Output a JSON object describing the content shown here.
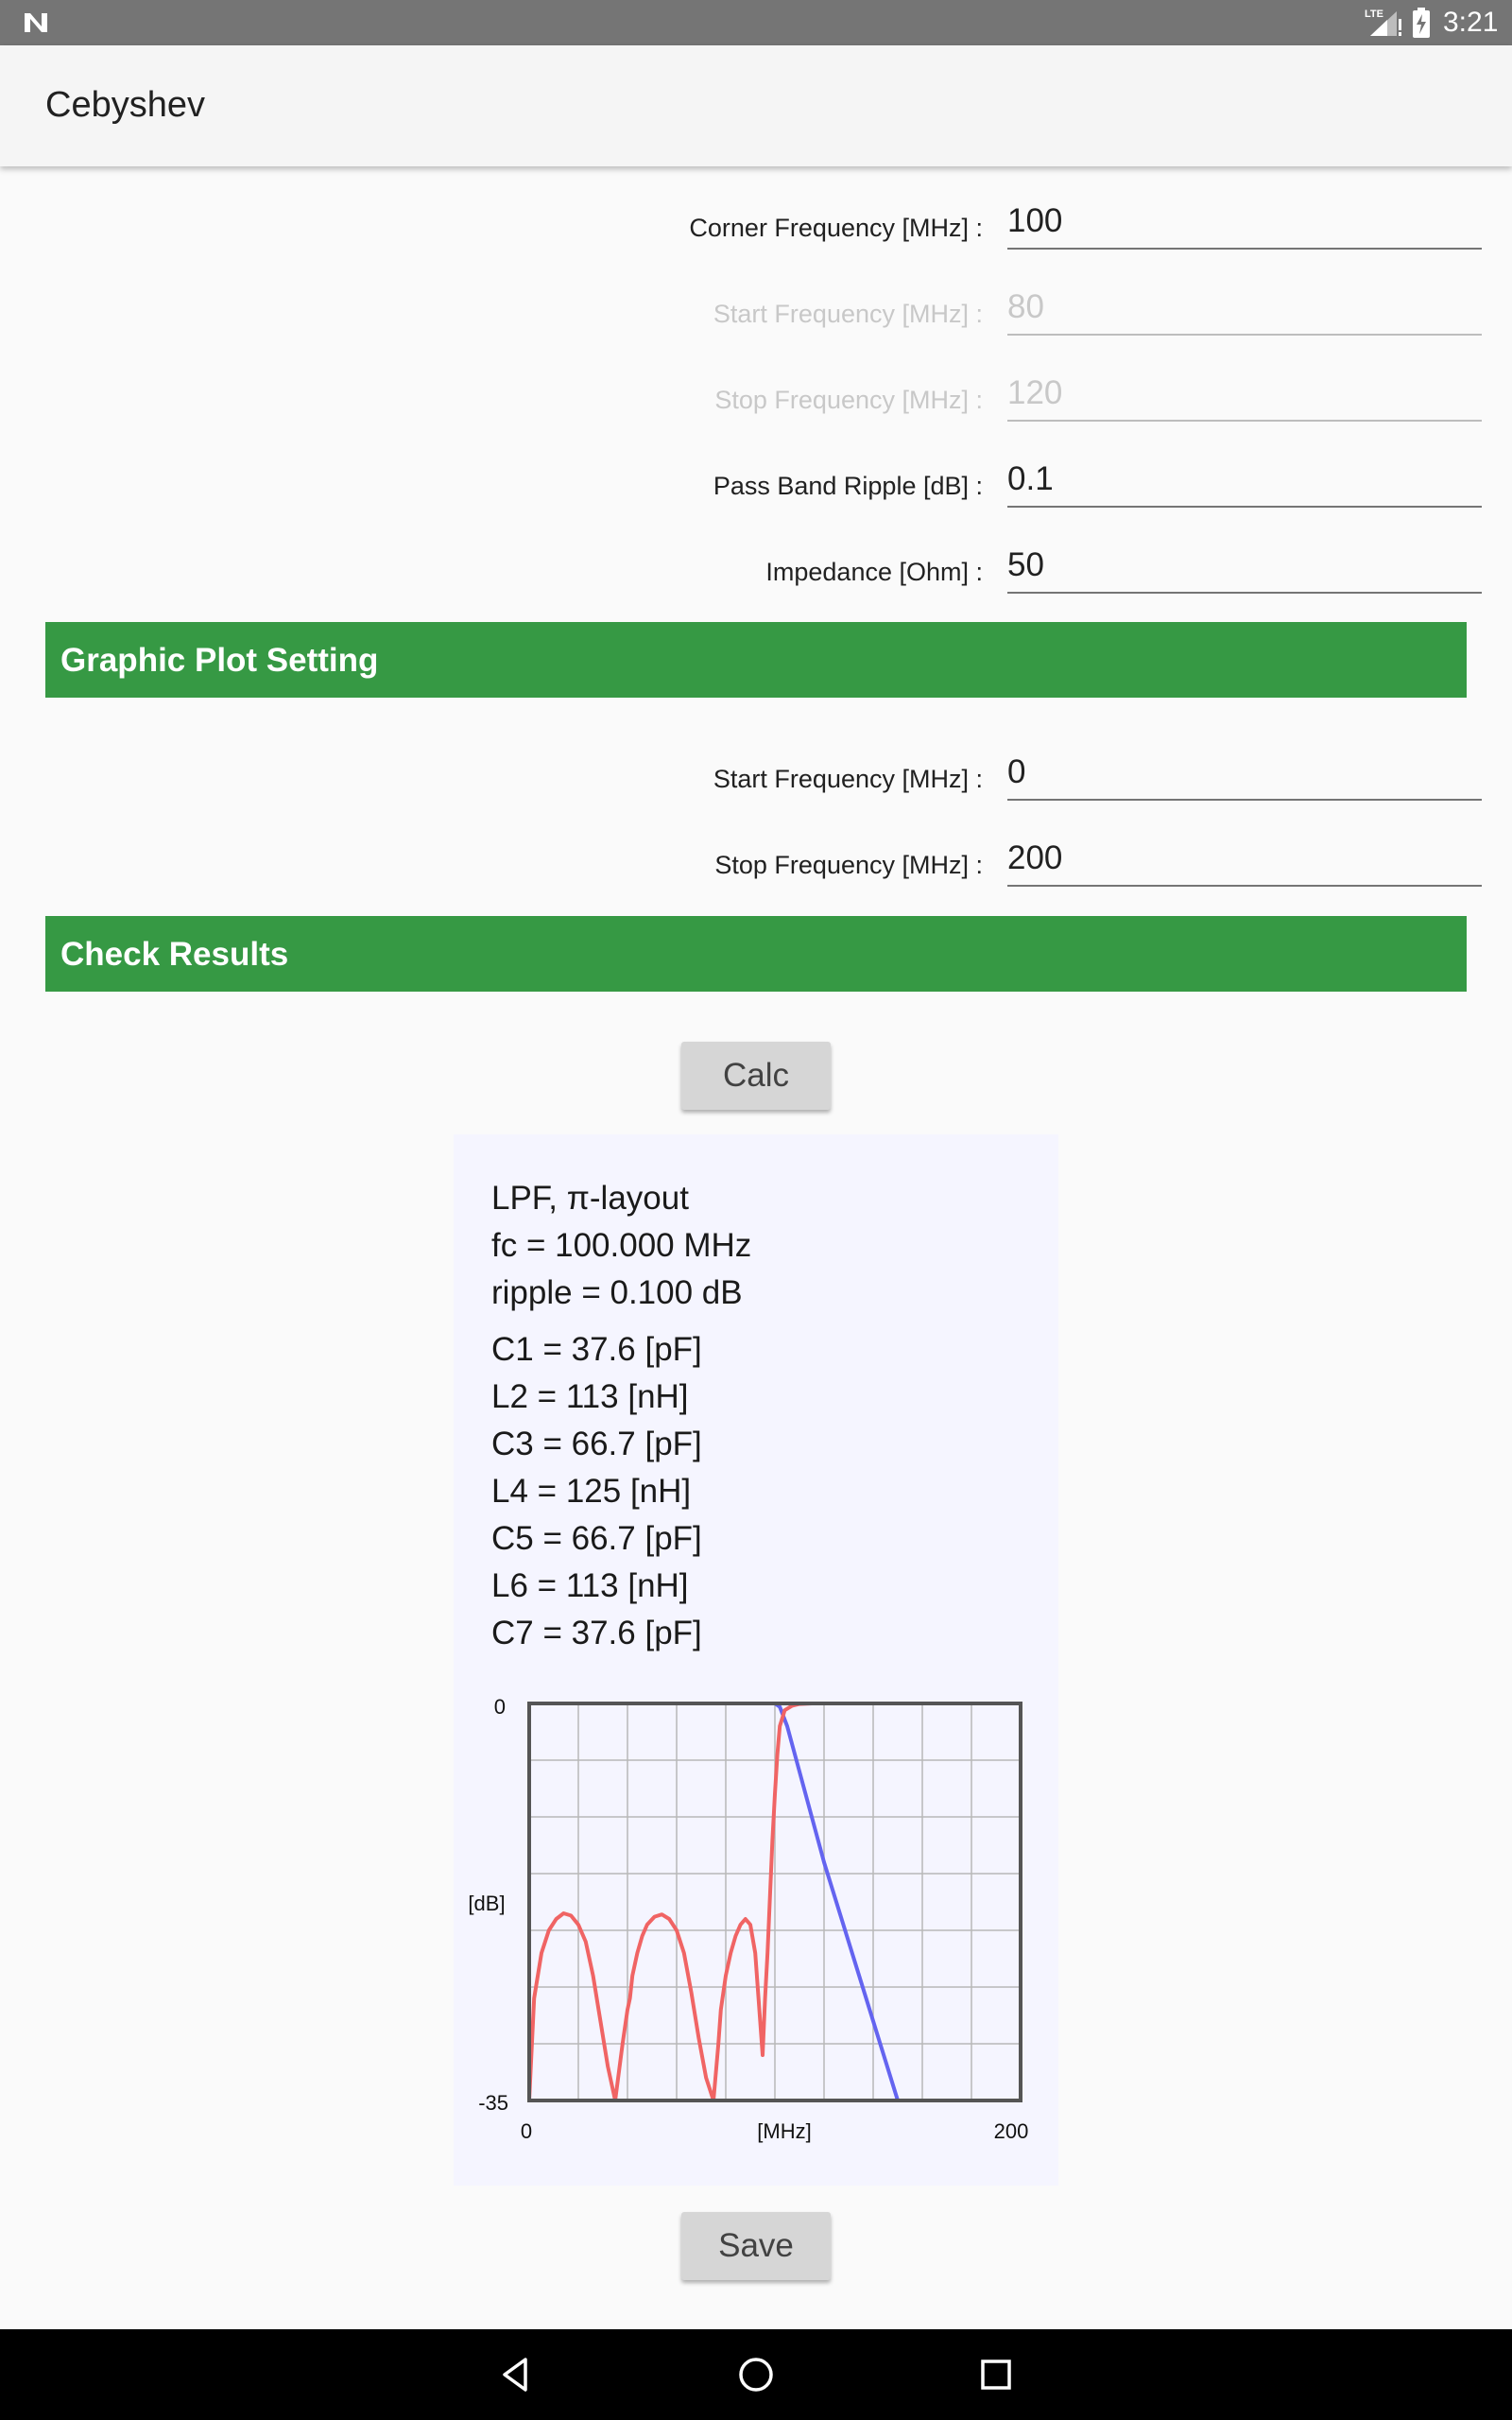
{
  "status_bar": {
    "time": "3:21",
    "network": "LTE"
  },
  "app_bar": {
    "title": "Cebyshev"
  },
  "form": {
    "corner": {
      "label": "Corner Frequency [MHz] :",
      "value": "100"
    },
    "start": {
      "label": "Start Frequency [MHz] :",
      "value": "80"
    },
    "stop": {
      "label": "Stop Frequency [MHz] :",
      "value": "120"
    },
    "ripple": {
      "label": "Pass Band Ripple [dB] :",
      "value": "0.1"
    },
    "impedance": {
      "label": "Impedance [Ohm] :",
      "value": "50"
    }
  },
  "plot_setting": {
    "header": "Graphic Plot Setting",
    "start": {
      "label": "Start Frequency [MHz] :",
      "value": "0"
    },
    "stop": {
      "label": "Stop Frequency [MHz] :",
      "value": "200"
    }
  },
  "results": {
    "header": "Check Results",
    "calc_label": "Calc",
    "save_label": "Save",
    "summary": [
      "LPF, π-layout",
      "fc = 100.000 MHz",
      "ripple = 0.100 dB"
    ],
    "components": [
      "C1 = 37.6 [pF]",
      "L2 = 113 [nH]",
      "C3 = 66.7 [pF]",
      "L4 = 125 [nH]",
      "C5 = 66.7 [pF]",
      "L6 = 113 [nH]",
      "C7 = 37.6 [pF]"
    ]
  },
  "colors": {
    "section_green": "#369944",
    "transmission": "#6464f0",
    "reflection": "#f06464"
  },
  "chart_data": {
    "type": "line",
    "ylabel": "[dB]",
    "xlabel": "[MHz]",
    "xlim": [
      0,
      200
    ],
    "ylim": [
      -35,
      0
    ],
    "y_tick_labels": [
      "0",
      "-35"
    ],
    "x_tick_labels": [
      "0",
      "200"
    ],
    "grid": true,
    "series": [
      {
        "color": "#6464f0",
        "x": [
          0,
          100,
          102,
          105,
          110,
          115,
          120,
          125,
          130,
          135,
          140,
          145,
          150,
          200
        ],
        "y": [
          0,
          0,
          -0.3,
          -2,
          -6,
          -10,
          -14,
          -17.5,
          -21,
          -24.5,
          -28,
          -31.5,
          -35,
          -35
        ]
      },
      {
        "color": "#f06464",
        "x": [
          0,
          2,
          5,
          8,
          11,
          14,
          17,
          20,
          23,
          26,
          29,
          32,
          35,
          38,
          40,
          41,
          42,
          44,
          46,
          48,
          51,
          54,
          57,
          60,
          63,
          66,
          69,
          72,
          75,
          77,
          78,
          80,
          82,
          84,
          86,
          88,
          90,
          92,
          93,
          94,
          95,
          96,
          97,
          98,
          99,
          100,
          101,
          102,
          104,
          107,
          110,
          115,
          120,
          200
        ],
        "y": [
          -35,
          -26,
          -22,
          -20,
          -19,
          -18.5,
          -18.7,
          -19.5,
          -21,
          -24,
          -28,
          -32,
          -35,
          -30,
          -27,
          -26,
          -24,
          -22,
          -20.5,
          -19.5,
          -18.8,
          -18.6,
          -19,
          -20,
          -22,
          -25.5,
          -29.5,
          -33,
          -35,
          -30,
          -27,
          -24,
          -22,
          -20.5,
          -19.5,
          -19,
          -19.5,
          -22,
          -25,
          -28,
          -31,
          -26,
          -22,
          -17,
          -12,
          -8,
          -4.5,
          -2,
          -0.6,
          -0.2,
          -0.05,
          0,
          0,
          0
        ]
      }
    ]
  }
}
